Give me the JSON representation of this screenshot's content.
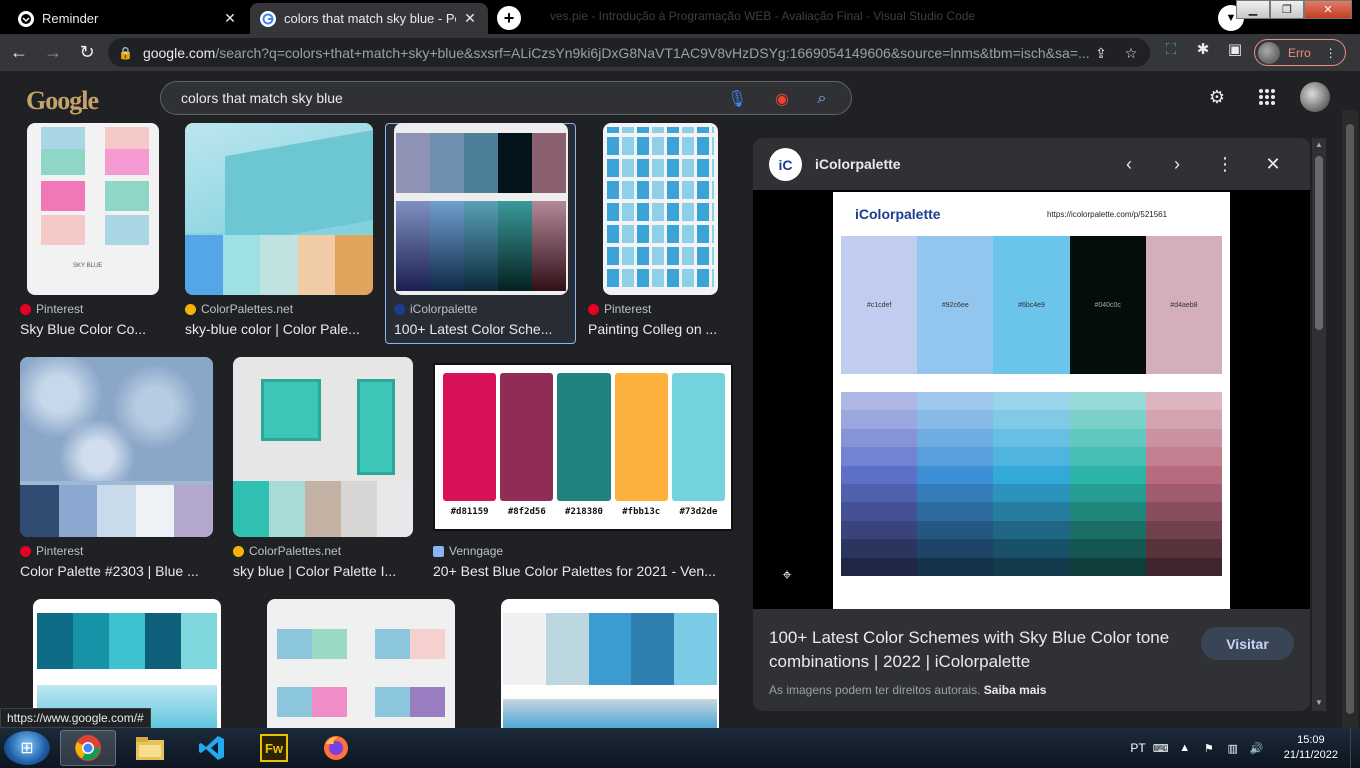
{
  "browser": {
    "tabs": [
      {
        "label": "Reminder",
        "favicon": "reminder-icon",
        "favicon_color": "#ffffff"
      },
      {
        "label": "colors that match sky blue - Pesq",
        "favicon": "google-icon",
        "favicon_color": "#4285f4"
      }
    ],
    "ghost_tab": "ves.pie - Introdução à Programação WEB - Avaliação Final - Visual Studio Code",
    "new_tab": "+",
    "omnibox": {
      "host": "google.com",
      "path": "/search?q=colors+that+match+sky+blue&sxsrf=ALiCzsYn9ki6jDxG8NaVT1AC9V8vHzDSYg:1669054149606&source=lnms&tbm=isch&sa=..."
    },
    "profile_label": "Erro",
    "status_url": "https://www.google.com/#"
  },
  "google": {
    "logo": "Google",
    "query": "colors that match sky blue"
  },
  "results": [
    {
      "source": "Pinterest",
      "title": "Sky Blue Color Co...",
      "fav_color": "#e60023"
    },
    {
      "source": "ColorPalettes.net",
      "title": "sky-blue color | Color Pale...",
      "fav_color": "#f4b400"
    },
    {
      "source": "iColorpalette",
      "title": "100+ Latest Color Sche...",
      "fav_color": "#1a3d8f"
    },
    {
      "source": "Pinterest",
      "title": "Painting Colleg on ...",
      "fav_color": "#e60023"
    },
    {
      "source": "Pinterest",
      "title": "Color Palette #2303 | Blue ...",
      "fav_color": "#e60023"
    },
    {
      "source": "ColorPalettes.net",
      "title": "sky blue | Color Palette I...",
      "fav_color": "#f4b400"
    },
    {
      "source": "Venngage",
      "title": "20+ Best Blue Color Palettes for 2021 - Ven...",
      "fav_color": "#8ab4f8"
    }
  ],
  "venngage_swatches": [
    {
      "color": "#d81159",
      "label": "#d81159"
    },
    {
      "color": "#8f2d56",
      "label": "#8f2d56"
    },
    {
      "color": "#218380",
      "label": "#218380"
    },
    {
      "color": "#fbb13c",
      "label": "#fbb13c"
    },
    {
      "color": "#73d2de",
      "label": "#73d2de"
    }
  ],
  "preview": {
    "site": "iColorpalette",
    "logo_text": "iC",
    "image_brand": "iColorpalette",
    "image_url": "https://icolorpalette.com/p/521561",
    "swatches": [
      {
        "color": "#c1cdef",
        "label": "#c1cdef"
      },
      {
        "color": "#92c6ee",
        "label": "#92c6ee"
      },
      {
        "color": "#6bc4e9",
        "label": "#6bc4e9"
      },
      {
        "color": "#040c0c",
        "label": "#040c0c"
      },
      {
        "color": "#d4aeb8",
        "label": "#d4aeb8"
      }
    ],
    "title": "100+ Latest Color Schemes with Sky Blue Color tone combinations | 2022 | iColorpalette",
    "visit_label": "Visitar",
    "rights_text": "As imagens podem ter direitos autorais.",
    "learn_more": "Saiba mais"
  },
  "taskbar": {
    "lang": "PT",
    "time": "15:09",
    "date": "21/11/2022",
    "apps": [
      "chrome",
      "explorer",
      "vscode",
      "fireworks",
      "firefox"
    ],
    "fireworks_label": "Fw"
  }
}
